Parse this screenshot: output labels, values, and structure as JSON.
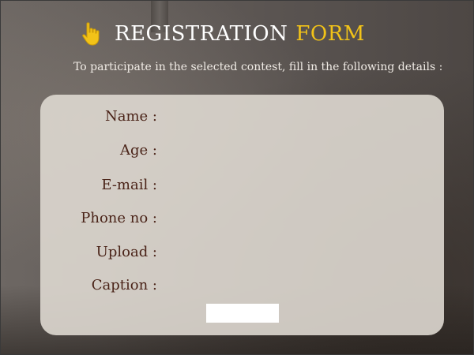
{
  "header": {
    "title_main": "REGISTRATION",
    "title_accent": "FORM",
    "icon": "hand-pointer-icon",
    "accent_color": "#f2c318"
  },
  "subtitle": "To participate in the selected contest, fill in the following details :",
  "form": {
    "fields": [
      {
        "label": "Name :",
        "value": ""
      },
      {
        "label": "Age :",
        "value": ""
      },
      {
        "label": "E-mail :",
        "value": ""
      },
      {
        "label": "Phone no :",
        "value": ""
      },
      {
        "label": "Upload :",
        "value": ""
      },
      {
        "label": "Caption :",
        "value": ""
      }
    ],
    "submit_label": ""
  },
  "colors": {
    "label_text": "#4a2318",
    "card_background": "#ded8d0"
  }
}
